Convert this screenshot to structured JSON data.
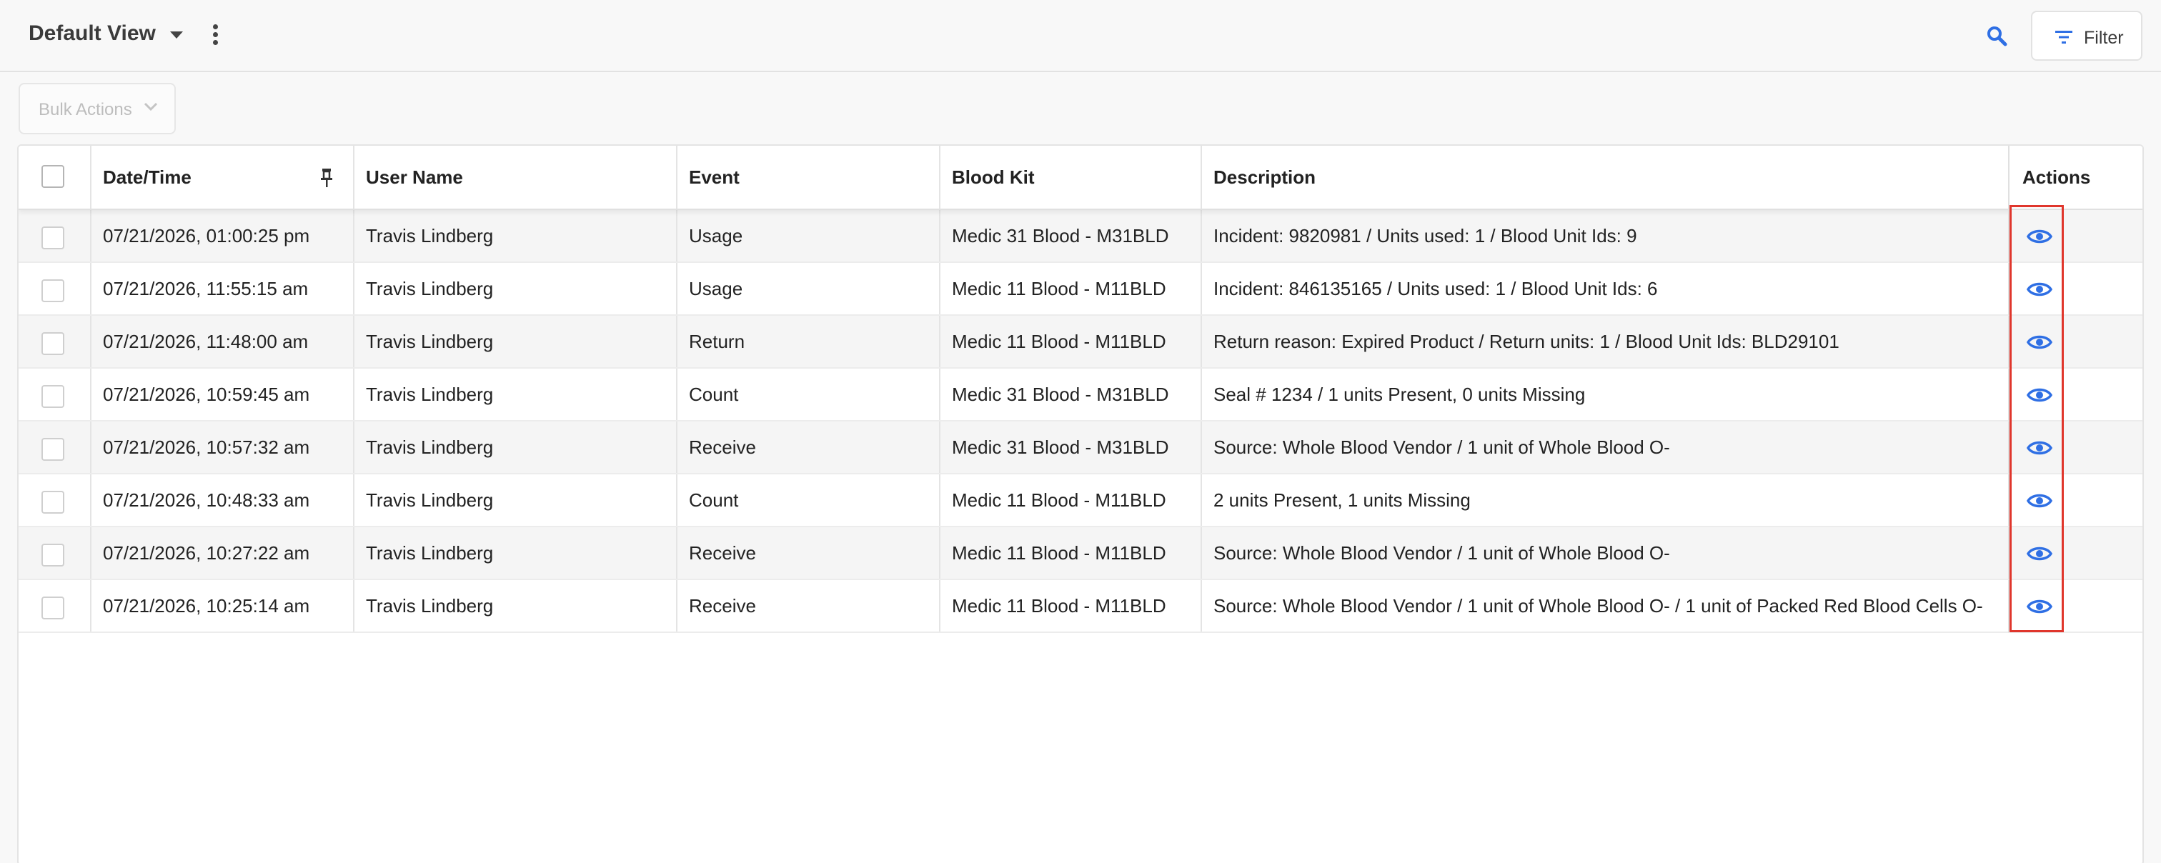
{
  "header": {
    "view_title": "Default View",
    "filter_label": "Filter"
  },
  "toolbar": {
    "bulk_actions_label": "Bulk Actions"
  },
  "table": {
    "columns": {
      "datetime": "Date/Time",
      "user": "User Name",
      "event": "Event",
      "kit": "Blood Kit",
      "description": "Description",
      "actions": "Actions"
    },
    "rows": [
      {
        "datetime": "07/21/2026, 01:00:25 pm",
        "user": "Travis Lindberg",
        "event": "Usage",
        "kit": "Medic 31 Blood - M31BLD",
        "description": "Incident: 9820981 / Units used: 1 / Blood Unit Ids: 9"
      },
      {
        "datetime": "07/21/2026, 11:55:15 am",
        "user": "Travis Lindberg",
        "event": "Usage",
        "kit": "Medic 11 Blood - M11BLD",
        "description": "Incident: 846135165 / Units used: 1 / Blood Unit Ids: 6"
      },
      {
        "datetime": "07/21/2026, 11:48:00 am",
        "user": "Travis Lindberg",
        "event": "Return",
        "kit": "Medic 11 Blood - M11BLD",
        "description": "Return reason: Expired Product / Return units: 1 / Blood Unit Ids: BLD29101"
      },
      {
        "datetime": "07/21/2026, 10:59:45 am",
        "user": "Travis Lindberg",
        "event": "Count",
        "kit": "Medic 31 Blood - M31BLD",
        "description": "Seal # 1234 / 1 units Present, 0 units Missing"
      },
      {
        "datetime": "07/21/2026, 10:57:32 am",
        "user": "Travis Lindberg",
        "event": "Receive",
        "kit": "Medic 31 Blood - M31BLD",
        "description": "Source: Whole Blood Vendor / 1 unit of Whole Blood O-"
      },
      {
        "datetime": "07/21/2026, 10:48:33 am",
        "user": "Travis Lindberg",
        "event": "Count",
        "kit": "Medic 11 Blood - M11BLD",
        "description": "2 units Present, 1 units Missing"
      },
      {
        "datetime": "07/21/2026, 10:27:22 am",
        "user": "Travis Lindberg",
        "event": "Receive",
        "kit": "Medic 11 Blood - M11BLD",
        "description": "Source: Whole Blood Vendor / 1 unit of Whole Blood O-"
      },
      {
        "datetime": "07/21/2026, 10:25:14 am",
        "user": "Travis Lindberg",
        "event": "Receive",
        "kit": "Medic 11 Blood - M11BLD",
        "description": "Source: Whole Blood Vendor / 1 unit of Whole Blood O- / 1 unit of Packed Red Blood Cells O-"
      }
    ]
  },
  "icons": {
    "view_dropdown": "caret-down-icon",
    "view_menu": "kebab-menu-icon",
    "search": "search-icon",
    "filter": "filter-lines-icon",
    "bulk_actions": "chevron-down-icon",
    "pin": "pin-icon",
    "row_action": "eye-icon"
  },
  "colors": {
    "accent": "#2f6fe4",
    "highlight_border": "#e0362c",
    "row_stripe": "#f5f5f5"
  }
}
